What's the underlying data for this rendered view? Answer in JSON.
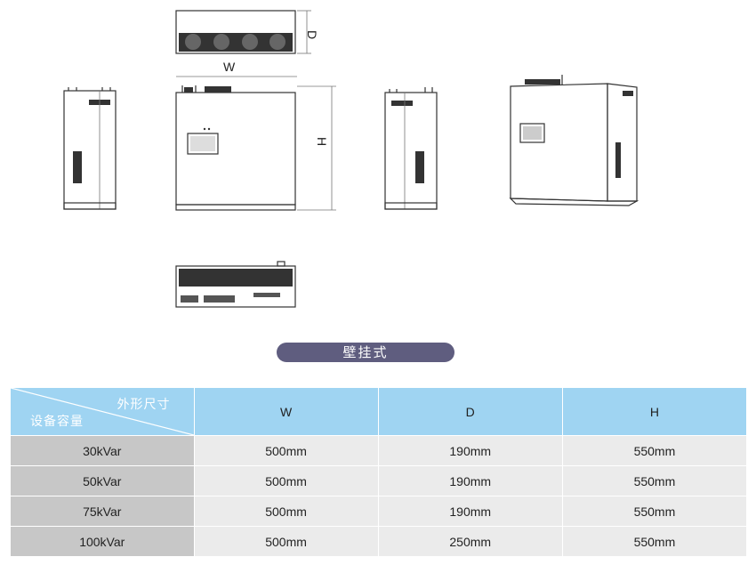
{
  "dimension_labels": {
    "width": "W",
    "depth": "D",
    "height": "H"
  },
  "mount_type_label": "壁挂式",
  "table": {
    "corner_top": "外形尺寸",
    "corner_bottom": "设备容量",
    "columns": [
      "W",
      "D",
      "H"
    ],
    "rows": [
      {
        "capacity": "30kVar",
        "w": "500mm",
        "d": "190mm",
        "h": "550mm"
      },
      {
        "capacity": "50kVar",
        "w": "500mm",
        "d": "190mm",
        "h": "550mm"
      },
      {
        "capacity": "75kVar",
        "w": "500mm",
        "d": "190mm",
        "h": "550mm"
      },
      {
        "capacity": "100kVar",
        "w": "500mm",
        "d": "250mm",
        "h": "550mm"
      }
    ]
  }
}
